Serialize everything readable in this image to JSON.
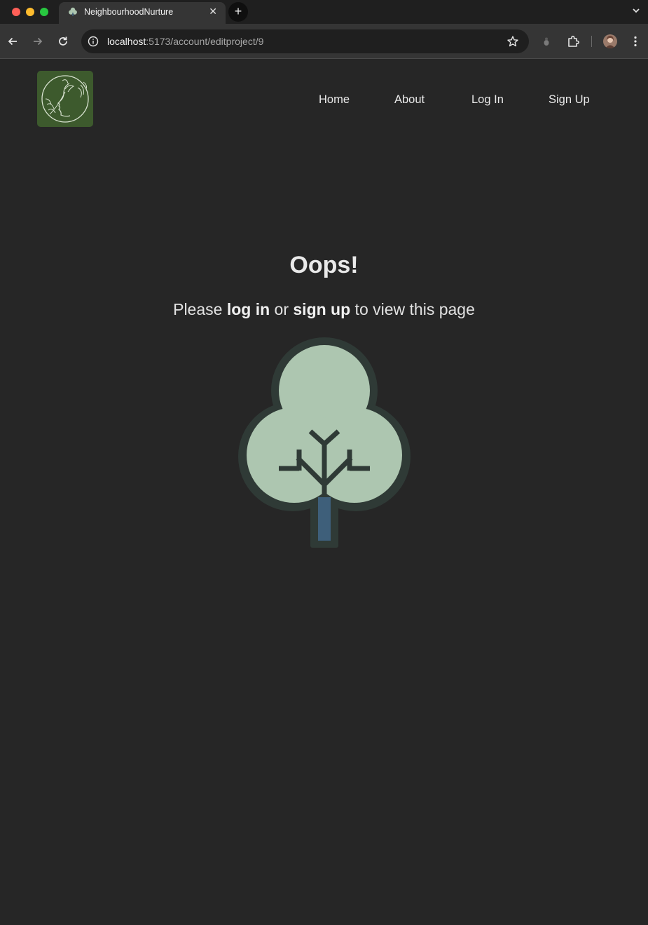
{
  "browser": {
    "tab": {
      "title": "NeighbourhoodNurture"
    },
    "address_bar": {
      "host": "localhost",
      "path": ":5173/account/editproject/9"
    }
  },
  "nav": {
    "home": "Home",
    "about": "About",
    "login": "Log In",
    "signup": "Sign Up"
  },
  "main": {
    "heading": "Oops!",
    "message": {
      "before": "Please ",
      "login_link": "log in",
      "middle": " or ",
      "signup_link": "sign up",
      "after": " to view this page"
    }
  },
  "colors": {
    "page_background": "#262626",
    "logo_background": "#3d5a2d",
    "tree_foliage": "#adc6b0",
    "tree_outline": "#2f3a36",
    "tree_trunk": "#3e5f7a"
  }
}
